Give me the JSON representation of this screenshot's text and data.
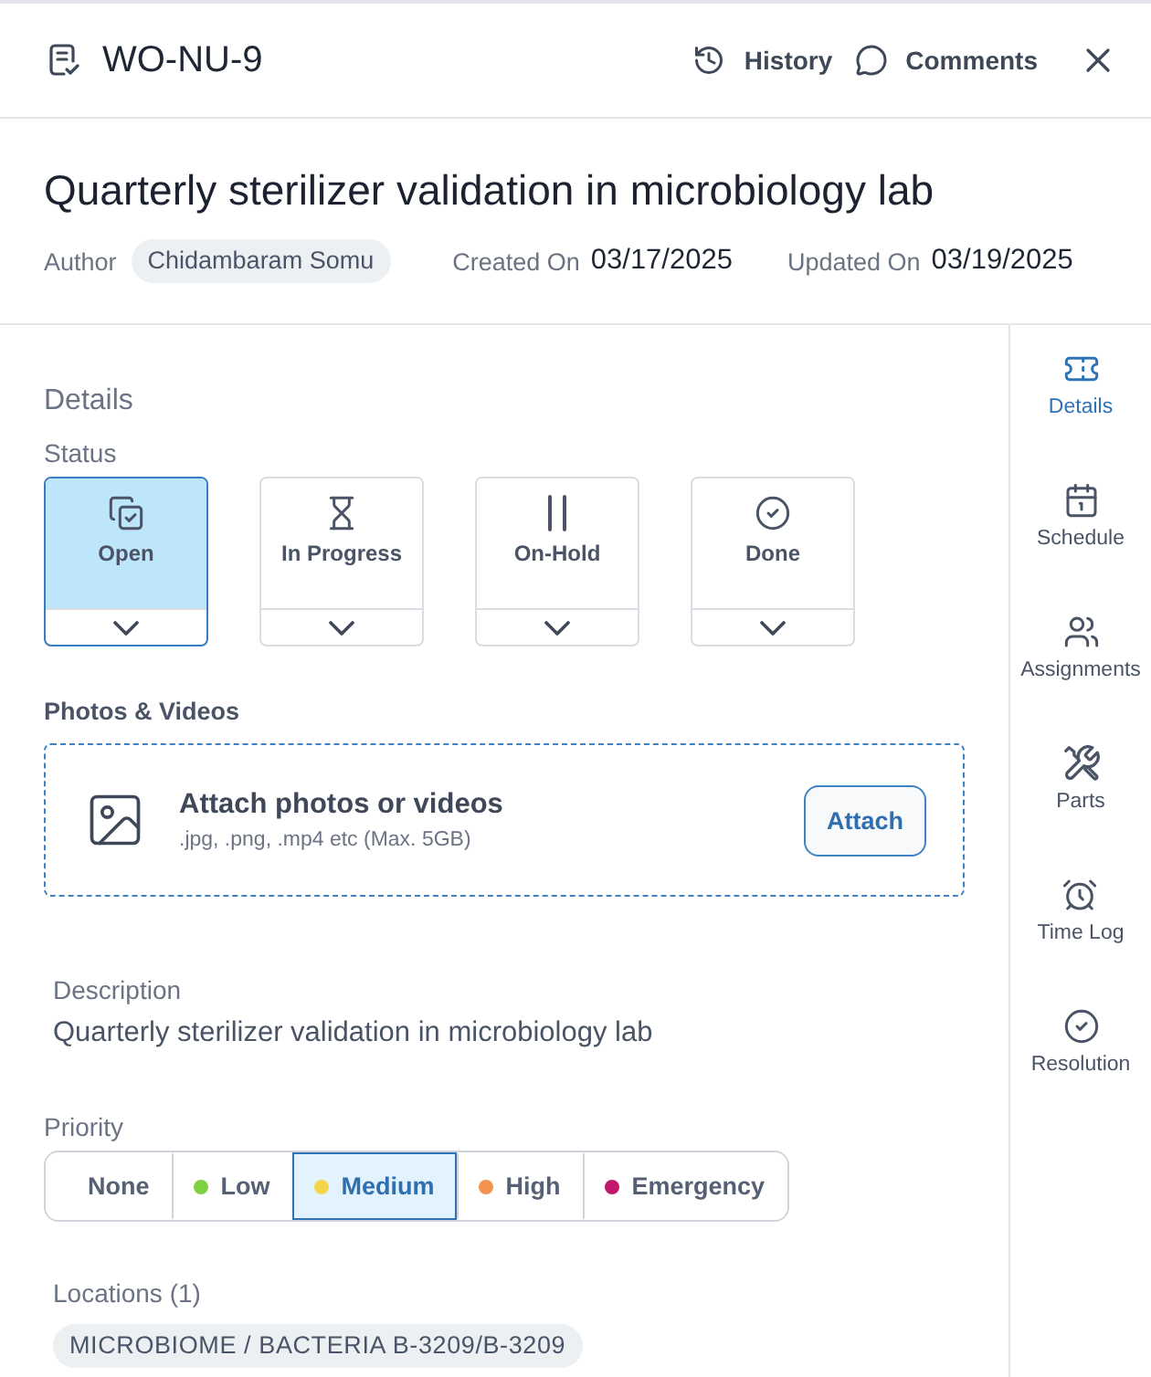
{
  "header": {
    "work_order_id": "WO-NU-9",
    "actions": [
      {
        "kind": "history",
        "label": "History"
      },
      {
        "kind": "comments",
        "label": "Comments"
      }
    ]
  },
  "title": "Quarterly sterilizer validation in microbiology lab",
  "meta": {
    "author_label": "Author",
    "author": "Chidambaram Somu",
    "created_label": "Created On",
    "created": "03/17/2025",
    "updated_label": "Updated On",
    "updated": "03/19/2025"
  },
  "details": {
    "heading": "Details",
    "status_label": "Status",
    "statuses": [
      {
        "kind": "open",
        "label": "Open",
        "selected": true
      },
      {
        "kind": "in_progress",
        "label": "In Progress",
        "selected": false
      },
      {
        "kind": "on_hold",
        "label": "On-Hold",
        "selected": false
      },
      {
        "kind": "done",
        "label": "Done",
        "selected": false
      }
    ]
  },
  "media": {
    "heading": "Photos & Videos",
    "title": "Attach photos or videos",
    "hint": ".jpg, .png, .mp4 etc (Max. 5GB)",
    "button": "Attach"
  },
  "description": {
    "label": "Description",
    "text": "Quarterly sterilizer validation in microbiology lab"
  },
  "priority": {
    "label": "Priority",
    "options": [
      {
        "label": "None",
        "selected": false
      },
      {
        "label": "Low",
        "color": "#7ed03e",
        "selected": false
      },
      {
        "label": "Medium",
        "color": "#f4d54c",
        "selected": true
      },
      {
        "label": "High",
        "color": "#f4934f",
        "selected": false
      },
      {
        "label": "Emergency",
        "color": "#c2186b",
        "selected": false
      }
    ]
  },
  "locations": {
    "label": "Locations (1)",
    "items": [
      "MICROBIOME / BACTERIA B-3209/B-3209"
    ]
  },
  "sidebar": {
    "items": [
      {
        "kind": "details",
        "label": "Details",
        "selected": true
      },
      {
        "kind": "schedule",
        "label": "Schedule",
        "selected": false
      },
      {
        "kind": "assignments",
        "label": "Assignments",
        "selected": false
      },
      {
        "kind": "parts",
        "label": "Parts",
        "selected": false
      },
      {
        "kind": "time_log",
        "label": "Time Log",
        "selected": false
      },
      {
        "kind": "resolution",
        "label": "Resolution",
        "selected": false
      }
    ]
  }
}
